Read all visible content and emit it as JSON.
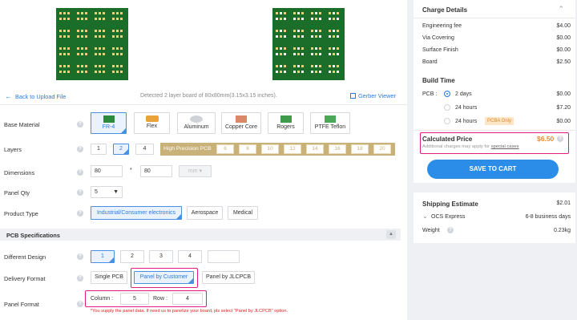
{
  "preview": {
    "back_link": "Back to Upload File",
    "detected_text": "Detected 2 layer board of 80x80mm(3.15x3.15 inches).",
    "gerber_viewer": "Gerber Viewer"
  },
  "form": {
    "base_material": {
      "label": "Base Material",
      "options": [
        "FR-4",
        "Flex",
        "Aluminum",
        "Copper Core",
        "Rogers",
        "PTFE Teflon"
      ],
      "selected": "FR-4"
    },
    "layers": {
      "label": "Layers",
      "options": [
        "1",
        "2",
        "4"
      ],
      "selected": "2",
      "high_precision_label": "High Precision PCB",
      "high_precision_options": [
        "6",
        "8",
        "10",
        "12",
        "14",
        "16",
        "18",
        "20"
      ]
    },
    "dimensions": {
      "label": "Dimensions",
      "width": "80",
      "height": "80",
      "separator": "*",
      "unit": "mm"
    },
    "panel_qty": {
      "label": "Panel Qty",
      "value": "5"
    },
    "product_type": {
      "label": "Product Type",
      "options": [
        "Industrial/Consumer electronics",
        "Aerospace",
        "Medical"
      ],
      "selected": "Industrial/Consumer electronics"
    },
    "section_title": "PCB Specifications",
    "different_design": {
      "label": "Different Design",
      "options": [
        "1",
        "2",
        "3",
        "4",
        ""
      ],
      "selected": "1"
    },
    "delivery_format": {
      "label": "Delivery Format",
      "options": [
        "Single PCB",
        "Panel by Customer",
        "Panel by JLCPCB"
      ],
      "selected": "Panel by Customer"
    },
    "panel_format": {
      "label": "Panel Format",
      "column_label": "Column :",
      "column_value": "5",
      "row_label": "Row :",
      "row_value": "4",
      "note": "*You supply the panel data. If need us to panelize your board, pls select \"Panel by JLCPCB\" option."
    }
  },
  "charges": {
    "title": "Charge Details",
    "items": [
      {
        "name": "Engineering fee",
        "price": "$4.00"
      },
      {
        "name": "Via Covering",
        "price": "$0.00"
      },
      {
        "name": "Surface Finish",
        "price": "$0.00"
      },
      {
        "name": "Board",
        "price": "$2.50"
      }
    ],
    "build_time": {
      "title": "Build Time",
      "pcb_label": "PCB :",
      "options": [
        {
          "label": "2 days",
          "price": "$0.00",
          "selected": true
        },
        {
          "label": "24 hours",
          "price": "$7.20",
          "selected": false
        },
        {
          "label": "24 hours",
          "price": "$0.00",
          "selected": false,
          "badge": "PCBA Only"
        }
      ]
    },
    "calculated": {
      "label": "Calculated Price",
      "price": "$6.50",
      "note_prefix": "Additional charges may apply for",
      "note_link": "special cases"
    },
    "save_button": "SAVE TO CART"
  },
  "shipping": {
    "title": "Shipping Estimate",
    "price": "$2.01",
    "method": "OCS Express",
    "days": "6-8 business days",
    "weight_label": "Weight",
    "weight_value": "0.23kg"
  },
  "colors": {
    "accent": "#2b8de8",
    "highlight": "#e01d82",
    "price": "#f0882a",
    "hp_bg": "#c8b27a"
  },
  "icons": [
    "arrow-left-icon",
    "gerber-viewer-icon",
    "help-icon",
    "chevron-up-icon",
    "chevron-down-icon",
    "caret-down-icon",
    "radio-icon"
  ]
}
